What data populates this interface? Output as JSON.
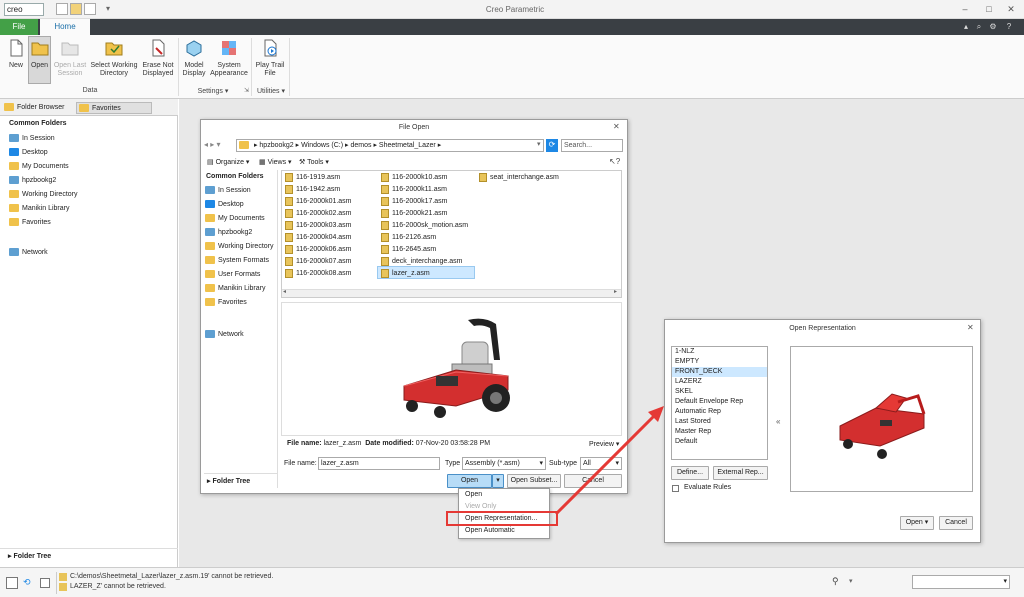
{
  "app": {
    "logo": "creo",
    "title": "Creo Parametric"
  },
  "tabs": {
    "file": "File",
    "home": "Home"
  },
  "ribbon": {
    "new": "New",
    "open": "Open",
    "open_last_session": "Open Last Session",
    "select_working_directory": "Select Working Directory",
    "erase_not_displayed": "Erase Not Displayed",
    "model_display": "Model Display",
    "system_appearance": "System Appearance",
    "play_trail_file": "Play Trail File",
    "group_data": "Data",
    "group_settings": "Settings",
    "group_utilities": "Utilities"
  },
  "left_panel": {
    "tab_folder_browser": "Folder Browser",
    "tab_favorites": "Favorites",
    "common_folders": "Common Folders",
    "items": [
      "In Session",
      "Desktop",
      "My Documents",
      "hpzbookg2",
      "Working Directory",
      "Manikin Library",
      "Favorites"
    ],
    "network": "Network",
    "folder_tree": "Folder Tree"
  },
  "file_open": {
    "title": "File Open",
    "breadcrumb": [
      "hpzbookg2",
      "Windows (C:)",
      "demos",
      "Sheetmetal_Lazer"
    ],
    "search_placeholder": "Search...",
    "organize": "Organize",
    "views": "Views",
    "tools": "Tools",
    "common_folders": "Common Folders",
    "sidebar": [
      "In Session",
      "Desktop",
      "My Documents",
      "hpzbookg2",
      "Working Directory",
      "System Formats",
      "User Formats",
      "Manikin Library",
      "Favorites"
    ],
    "network": "Network",
    "folder_tree": "Folder Tree",
    "files_col1": [
      "116-1919.asm",
      "116-1942.asm",
      "116-2000k01.asm",
      "116-2000k02.asm",
      "116-2000k03.asm",
      "116-2000k04.asm",
      "116-2000k06.asm",
      "116-2000k07.asm",
      "116-2000k08.asm"
    ],
    "files_col2": [
      "116-2000k10.asm",
      "116-2000k11.asm",
      "116-2000k17.asm",
      "116-2000k21.asm",
      "116-2000sk_motion.asm",
      "116-2126.asm",
      "116-2645.asm",
      "deck_interchange.asm",
      "lazer_z.asm"
    ],
    "files_col3": [
      "seat_interchange.asm"
    ],
    "info_file_label": "File name:",
    "info_file_value": "lazer_z.asm",
    "info_date_label": "Date modified:",
    "info_date_value": "07-Nov-20 03:58:28 PM",
    "preview": "Preview",
    "file_name_label": "File name:",
    "file_name_value": "lazer_z.asm",
    "type_label": "Type",
    "type_value": "Assembly (*.asm)",
    "subtype_label": "Sub-type",
    "subtype_value": "All",
    "open_btn": "Open",
    "open_subset": "Open Subset...",
    "cancel": "Cancel",
    "menu": [
      "Open",
      "View Only",
      "Open Representation...",
      "Open Automatic"
    ]
  },
  "open_rep": {
    "title": "Open Representation",
    "items": [
      "1-NLZ",
      "EMPTY",
      "FRONT_DECK",
      "LAZERZ",
      "SKEL",
      "Default Envelope Rep",
      "Automatic Rep",
      "Last Stored",
      "Master Rep",
      "Default"
    ],
    "selected_index": 2,
    "collapse": "«",
    "define": "Define...",
    "external_rep": "External Rep...",
    "evaluate_rules": "Evaluate Rules",
    "open": "Open",
    "cancel": "Cancel"
  },
  "status": {
    "msg1": "C:\\demos\\Sheetmetal_Lazer\\lazer_z.asm.19' cannot be retrieved.",
    "msg2": "LAZER_Z' cannot be retrieved."
  },
  "colors": {
    "accent": "#43a047",
    "selection": "#cde8ff",
    "highlight": "#e53935"
  }
}
